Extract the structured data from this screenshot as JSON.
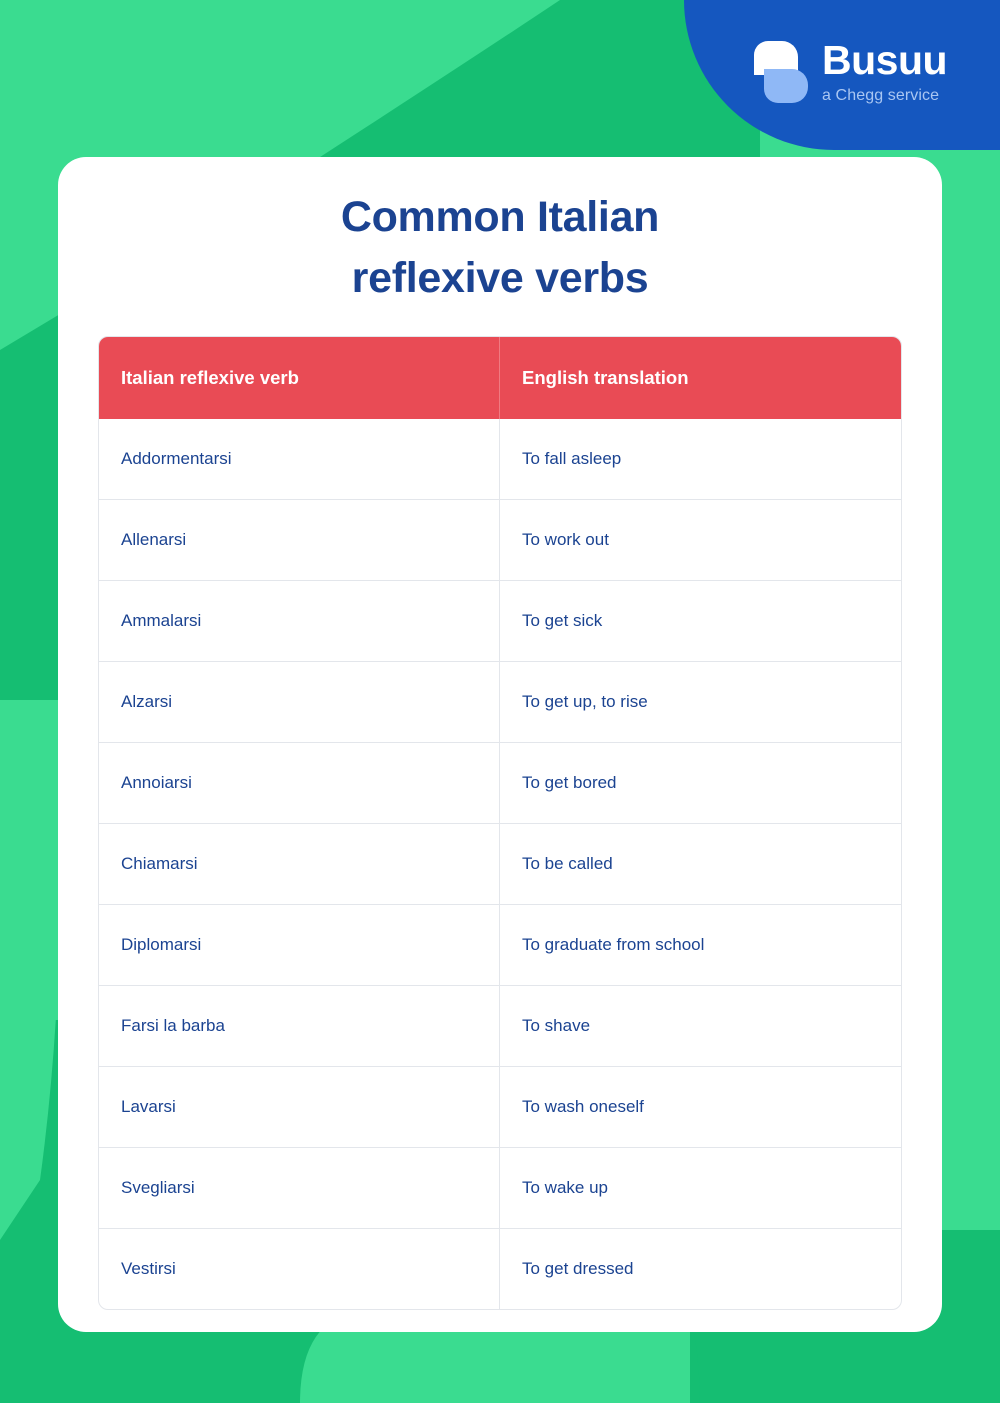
{
  "brand": {
    "name": "Busuu",
    "tagline": "a Chegg service",
    "logo_icon": "busuu-speech-blob-logo",
    "badge_color": "#1557BF",
    "logo_accent_color": "#8FB8F6"
  },
  "background": {
    "base_green": "#15BE72",
    "light_green": "#3ADC90"
  },
  "card": {
    "title_line1": "Common Italian",
    "title_line2": "reflexive verbs",
    "title_color": "#1B4391",
    "background": "#FFFFFF"
  },
  "table": {
    "header_background": "#E94B55",
    "header_text_color": "#FFFFFF",
    "body_text_color": "#1B4391",
    "border_color": "#E3E6EB",
    "columns": [
      "Italian reflexive verb",
      "English translation"
    ],
    "rows": [
      {
        "verb": "Addormentarsi",
        "translation": "To fall asleep"
      },
      {
        "verb": "Allenarsi",
        "translation": "To work out"
      },
      {
        "verb": "Ammalarsi",
        "translation": "To get sick"
      },
      {
        "verb": "Alzarsi",
        "translation": "To get up, to rise"
      },
      {
        "verb": "Annoiarsi",
        "translation": "To get bored"
      },
      {
        "verb": "Chiamarsi",
        "translation": "To be called"
      },
      {
        "verb": "Diplomarsi",
        "translation": "To graduate from school"
      },
      {
        "verb": "Farsi la barba",
        "translation": "To shave"
      },
      {
        "verb": "Lavarsi",
        "translation": "To wash oneself"
      },
      {
        "verb": "Svegliarsi",
        "translation": "To wake up"
      },
      {
        "verb": "Vestirsi",
        "translation": "To get dressed"
      }
    ]
  }
}
